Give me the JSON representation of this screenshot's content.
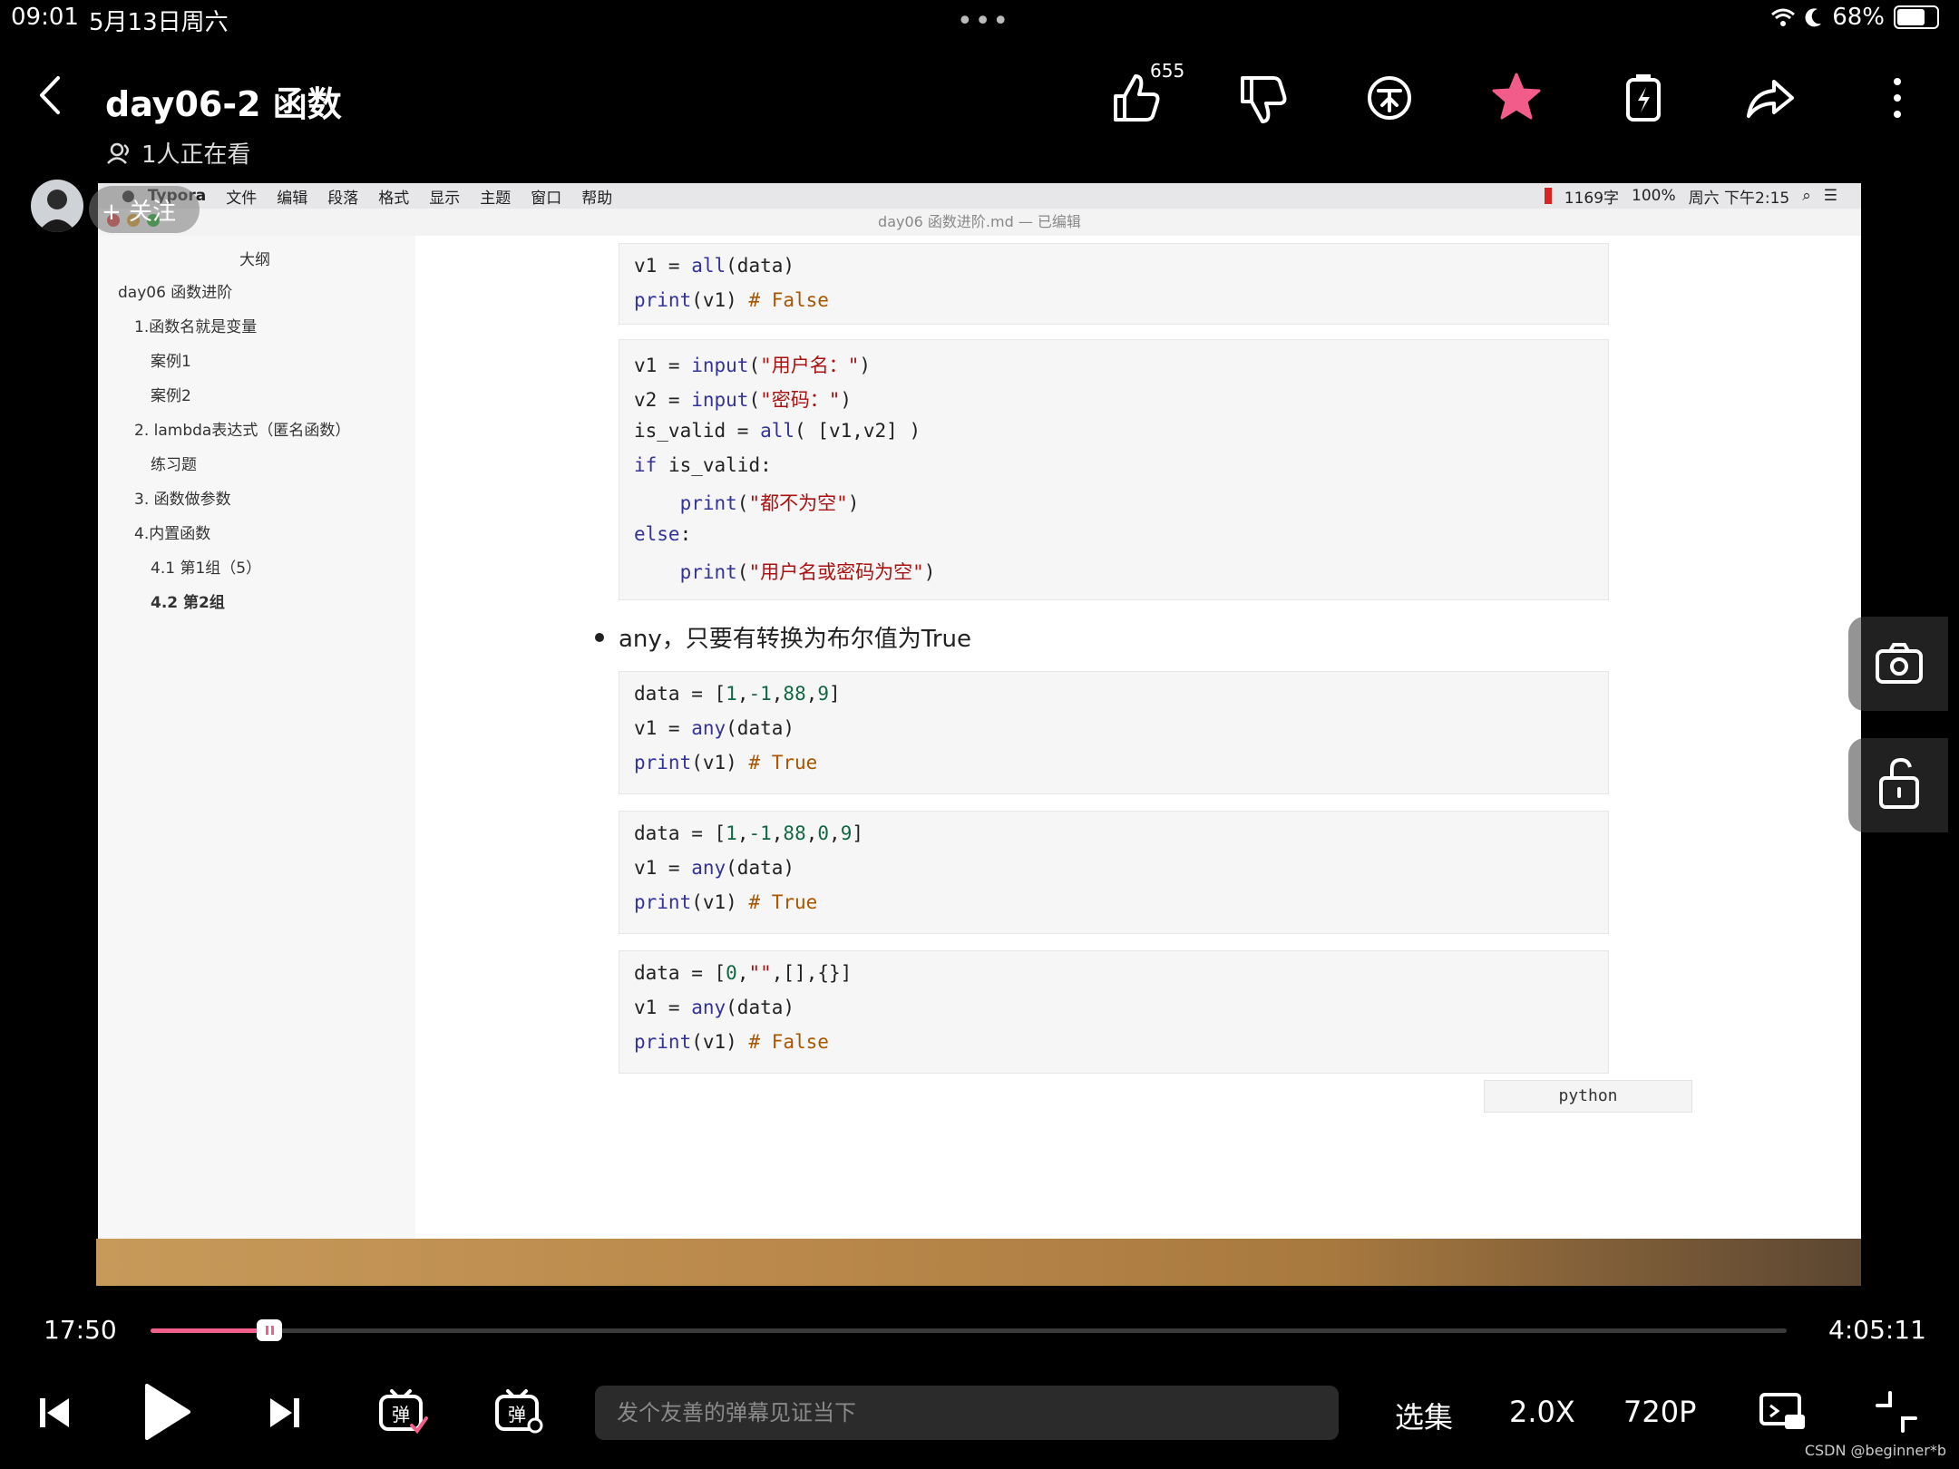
{
  "status": {
    "time": "09:01",
    "date": "5月13日周六",
    "battery": "68%"
  },
  "header": {
    "title": "day06-2 函数",
    "viewers": "1人正在看",
    "like_count": "655"
  },
  "follow": {
    "label": "+ 关注"
  },
  "mac": {
    "app": "Typora",
    "menus": [
      "文件",
      "编辑",
      "段落",
      "格式",
      "显示",
      "主题",
      "窗口",
      "帮助"
    ],
    "status_right": "1169字",
    "battery": "100%",
    "clock": "周六 下午2:15",
    "window_title": "day06 函数进阶.md — 已编辑"
  },
  "outline": {
    "heading": "大纲",
    "items": [
      {
        "label": "day06 函数进阶",
        "level": 0,
        "bold": false
      },
      {
        "label": "1.函数名就是变量",
        "level": 1,
        "bold": false
      },
      {
        "label": "案例1",
        "level": 2,
        "bold": false
      },
      {
        "label": "案例2",
        "level": 2,
        "bold": false
      },
      {
        "label": "2. lambda表达式（匿名函数）",
        "level": 1,
        "bold": false
      },
      {
        "label": "练习题",
        "level": 2,
        "bold": false
      },
      {
        "label": "3. 函数做参数",
        "level": 1,
        "bold": false
      },
      {
        "label": "4.内置函数",
        "level": 1,
        "bold": false
      },
      {
        "label": "4.1 第1组（5）",
        "level": 2,
        "bold": false
      },
      {
        "label": "4.2 第2组",
        "level": 2,
        "bold": true
      }
    ]
  },
  "editor": {
    "bullet": "any，只要有转换为布尔值为True",
    "language_label": "python",
    "block1": [
      [
        [
          "v1 = ",
          ""
        ],
        [
          "all",
          "kw"
        ],
        [
          "(data)",
          ""
        ]
      ],
      [
        [
          "print",
          "kw"
        ],
        [
          "(v1) ",
          ""
        ],
        [
          "# False",
          "cm"
        ]
      ]
    ],
    "block2": [
      [
        [
          "v1 = ",
          ""
        ],
        [
          "input",
          "kw"
        ],
        [
          "(",
          ""
        ],
        [
          "\"用户名：\"",
          "str"
        ],
        [
          ")",
          ""
        ]
      ],
      [
        [
          "v2 = ",
          ""
        ],
        [
          "input",
          "kw"
        ],
        [
          "(",
          ""
        ],
        [
          "\"密码：\"",
          "str"
        ],
        [
          ")",
          ""
        ]
      ],
      [
        [
          "is_valid = ",
          ""
        ],
        [
          "all",
          "kw"
        ],
        [
          "( [v1,v2] )",
          ""
        ]
      ],
      [
        [
          "if",
          "kw"
        ],
        [
          " is_valid:",
          ""
        ]
      ],
      [
        [
          "    ",
          ""
        ],
        [
          "print",
          "kw"
        ],
        [
          "(",
          ""
        ],
        [
          "\"都不为空\"",
          "str"
        ],
        [
          ")",
          ""
        ]
      ],
      [
        [
          "else",
          "kw"
        ],
        [
          ":",
          ""
        ]
      ],
      [
        [
          "    ",
          ""
        ],
        [
          "print",
          "kw"
        ],
        [
          "(",
          ""
        ],
        [
          "\"用户名或密码为空\"",
          "str"
        ],
        [
          ")",
          ""
        ]
      ]
    ],
    "block3": [
      [
        [
          "data = [",
          ""
        ],
        [
          "1",
          "num"
        ],
        [
          ",",
          ""
        ],
        [
          "-1",
          "num"
        ],
        [
          ",",
          ""
        ],
        [
          "88",
          "num"
        ],
        [
          ",",
          ""
        ],
        [
          "9",
          "num"
        ],
        [
          "]",
          ""
        ]
      ],
      [
        [
          "v1 = ",
          ""
        ],
        [
          "any",
          "kw"
        ],
        [
          "(data)",
          ""
        ]
      ],
      [
        [
          "print",
          "kw"
        ],
        [
          "(v1) ",
          ""
        ],
        [
          "# True",
          "cm"
        ]
      ]
    ],
    "block4": [
      [
        [
          "data = [",
          ""
        ],
        [
          "1",
          "num"
        ],
        [
          ",",
          ""
        ],
        [
          "-1",
          "num"
        ],
        [
          ",",
          ""
        ],
        [
          "88",
          "num"
        ],
        [
          ",",
          ""
        ],
        [
          "0",
          "num"
        ],
        [
          ",",
          ""
        ],
        [
          "9",
          "num"
        ],
        [
          "]",
          ""
        ]
      ],
      [
        [
          "v1 = ",
          ""
        ],
        [
          "any",
          "kw"
        ],
        [
          "(data)",
          ""
        ]
      ],
      [
        [
          "print",
          "kw"
        ],
        [
          "(v1) ",
          ""
        ],
        [
          "# True",
          "cm"
        ]
      ]
    ],
    "block5": [
      [
        [
          "data = [",
          ""
        ],
        [
          "0",
          "num"
        ],
        [
          ",",
          ""
        ],
        [
          "\"\"",
          "str"
        ],
        [
          ",[],{}]",
          ""
        ]
      ],
      [
        [
          "v1 = ",
          ""
        ],
        [
          "any",
          "kw"
        ],
        [
          "(data)",
          ""
        ]
      ],
      [
        [
          "print",
          "kw"
        ],
        [
          "(v1) ",
          ""
        ],
        [
          "# False",
          "cm"
        ]
      ]
    ]
  },
  "player": {
    "current_time": "17:50",
    "total_time": "4:05:11",
    "progress": 0.0726,
    "danmaku_placeholder": "发个友善的弹幕见证当下",
    "episodes": "选集",
    "speed": "2.0X",
    "quality": "720P",
    "danmaku_label": "弹"
  },
  "watermark": "CSDN @beginner*b",
  "colors": {
    "accent": "#f0608a",
    "star": "#f25c8a"
  }
}
